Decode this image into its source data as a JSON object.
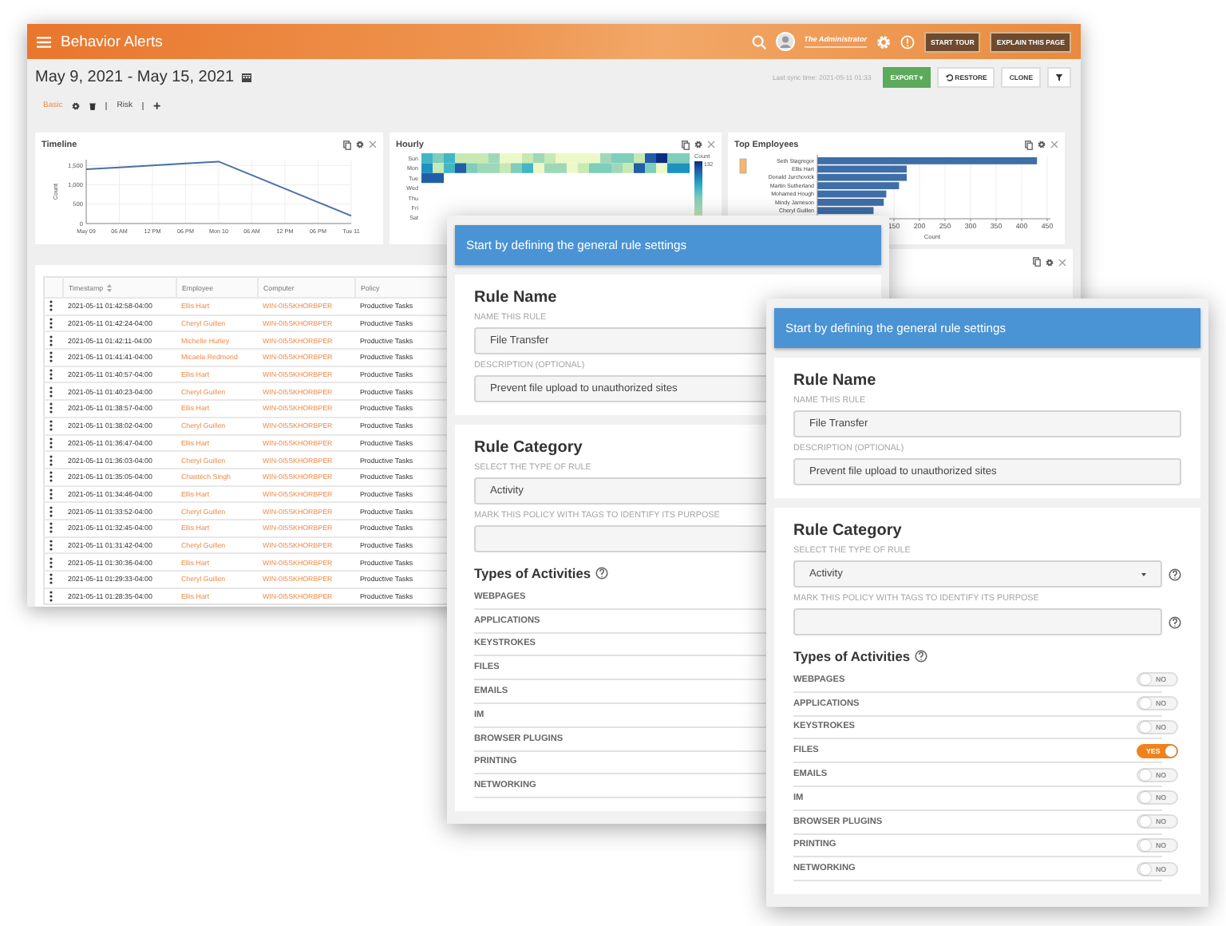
{
  "dashboard": {
    "header": {
      "title": "Behavior Alerts",
      "user": "The Administrator",
      "buttons": [
        "START TOUR",
        "EXPLAIN THIS PAGE"
      ]
    },
    "date_range": "May 9, 2021 - May 15, 2021",
    "sync": "Last sync time: 2021-05-11 01:33",
    "actions": [
      {
        "kind": "export",
        "label": "EXPORT ▾"
      },
      {
        "kind": "restore",
        "label": "RESTORE"
      },
      {
        "kind": "plain",
        "label": "CLONE"
      },
      {
        "kind": "filter"
      }
    ],
    "tabs": [
      {
        "label": "Basic",
        "selected": true
      },
      {
        "label": "Risk",
        "selected": false
      }
    ],
    "add_tab": "+",
    "panels": [
      {
        "title": "Timeline",
        "chart_data": {
          "type": "line",
          "ylabel": "Count",
          "grid": true,
          "ylim": [
            0,
            1650
          ],
          "categories": [
            "May 09",
            "06 AM",
            "12 PM",
            "06 PM",
            "Mon 10",
            "06 AM",
            "12 PM",
            "06 PM",
            "Tue 11"
          ],
          "series": [
            {
              "color": "#4a6fa5",
              "values": [
                1400,
                1450,
                1500,
                1550,
                1600,
                1250,
                900,
                550,
                200
              ]
            }
          ],
          "yticks": [
            {
              "value": 0,
              "label": "0"
            },
            {
              "value": 500,
              "label": "500"
            },
            {
              "value": 1000,
              "label": "1,000"
            },
            {
              "value": 1500,
              "label": "1,500"
            }
          ]
        }
      },
      {
        "kind": "heatmap",
        "title": "Hourly",
        "days": [
          "Sun",
          "Mon",
          "Tue",
          "Wed",
          "Thu",
          "Fri",
          "Sat"
        ],
        "legend_title": "Count",
        "legend_max": "132"
      },
      {
        "title": "Top Employees",
        "chart_data": {
          "type": "bar",
          "orientation": "horizontal",
          "xlabel": "Count",
          "grid": true,
          "xlim": [
            0,
            450
          ],
          "categories": [
            "Seth Stagregor",
            "Ellis Hart",
            "Donald Jurchovick",
            "Martin Sutherland",
            "Mohamed Hough",
            "Mindy Jameson",
            "Cheryl Guillen"
          ],
          "series": [
            {
              "color": "#3f6ea8",
              "values": [
                430,
                175,
                175,
                160,
                135,
                130,
                110
              ]
            }
          ],
          "xticks": [
            150,
            200,
            250,
            300,
            350,
            400,
            450
          ]
        }
      }
    ],
    "table": {
      "columns": [
        "Timestamp",
        "Employee",
        "Computer",
        "Policy"
      ],
      "rows": [
        [
          "2021-05-11 01:42:58-04:00",
          "Ellis Hart",
          "WIN-0I5SKHORBPER",
          "Productive Tasks"
        ],
        [
          "2021-05-11 01:42:24-04:00",
          "Cheryl Guillen",
          "WIN-0I5SKHORBPER",
          "Productive Tasks"
        ],
        [
          "2021-05-11 01:42:11-04:00",
          "Michelle Hurley",
          "WIN-0I5SKHORBPER",
          "Productive Tasks"
        ],
        [
          "2021-05-11 01:41:41-04:00",
          "Micaela Redmond",
          "WIN-0I5SKHORBPER",
          "Productive Tasks"
        ],
        [
          "2021-05-11 01:40:57-04:00",
          "Ellis Hart",
          "WIN-0I5SKHORBPER",
          "Productive Tasks"
        ],
        [
          "2021-05-11 01:40:23-04:00",
          "Cheryl Guillen",
          "WIN-0I5SKHORBPER",
          "Productive Tasks"
        ],
        [
          "2021-05-11 01:38:57-04:00",
          "Ellis Hart",
          "WIN-0I5SKHORBPER",
          "Productive Tasks"
        ],
        [
          "2021-05-11 01:38:02-04:00",
          "Cheryl Guillen",
          "WIN-0I5SKHORBPER",
          "Productive Tasks"
        ],
        [
          "2021-05-11 01:36:47-04:00",
          "Ellis Hart",
          "WIN-0I5SKHORBPER",
          "Productive Tasks"
        ],
        [
          "2021-05-11 01:36:03-04:00",
          "Cheryl Guillen",
          "WIN-0I5SKHORBPER",
          "Productive Tasks"
        ],
        [
          "2021-05-11 01:35:05-04:00",
          "Chastech Singh",
          "WIN-0I5SKHORBPER",
          "Productive Tasks"
        ],
        [
          "2021-05-11 01:34:46-04:00",
          "Ellis Hart",
          "WIN-0I5SKHORBPER",
          "Productive Tasks"
        ],
        [
          "2021-05-11 01:33:52-04:00",
          "Cheryl Guillen",
          "WIN-0I5SKHORBPER",
          "Productive Tasks"
        ],
        [
          "2021-05-11 01:32:45-04:00",
          "Ellis Hart",
          "WIN-0I5SKHORBPER",
          "Productive Tasks"
        ],
        [
          "2021-05-11 01:31:42-04:00",
          "Cheryl Guillen",
          "WIN-0I5SKHORBPER",
          "Productive Tasks"
        ],
        [
          "2021-05-11 01:30:36-04:00",
          "Ellis Hart",
          "WIN-0I5SKHORBPER",
          "Productive Tasks"
        ],
        [
          "2021-05-11 01:29:33-04:00",
          "Cheryl Guillen",
          "WIN-0I5SKHORBPER",
          "Productive Tasks"
        ],
        [
          "2021-05-11 01:28:35-04:00",
          "Ellis Hart",
          "WIN-0I5SKHORBPER",
          "Productive Tasks"
        ]
      ]
    }
  },
  "dialogs": [
    {
      "header": "Start by defining the general rule settings",
      "name_section": {
        "title": "Rule Name",
        "name_label": "NAME THIS RULE",
        "name_value": "File Transfer",
        "description_label": "DESCRIPTION (OPTIONAL)",
        "description_value": "Prevent file upload to unauthorized sites"
      },
      "category_section": {
        "title": "Rule Category",
        "type_label": "SELECT THE TYPE OF RULE",
        "type_value": "Activity",
        "tags_label": "MARK THIS POLICY WITH TAGS TO IDENTIFY ITS PURPOSE",
        "activities_title": "Types of Activities"
      },
      "activities": [
        {
          "label": "WEBPAGES"
        },
        {
          "label": "APPLICATIONS"
        },
        {
          "label": "KEYSTROKES"
        },
        {
          "label": "FILES"
        },
        {
          "label": "EMAILS"
        },
        {
          "label": "IM"
        },
        {
          "label": "BROWSER PLUGINS"
        },
        {
          "label": "PRINTING"
        },
        {
          "label": "NETWORKING"
        }
      ]
    },
    {
      "header": "Start by defining the general rule settings",
      "name_section": {
        "title": "Rule Name",
        "name_label": "NAME THIS RULE",
        "name_value": "File Transfer",
        "description_label": "DESCRIPTION (OPTIONAL)",
        "description_value": "Prevent file upload to unauthorized sites"
      },
      "category_section": {
        "title": "Rule Category",
        "type_label": "SELECT THE TYPE OF RULE",
        "type_value": "Activity",
        "tags_label": "MARK THIS POLICY WITH TAGS TO IDENTIFY ITS PURPOSE",
        "activities_title": "Types of Activities",
        "field_help": true
      },
      "activities": [
        {
          "label": "WEBPAGES",
          "on": false,
          "toggle_text": "NO"
        },
        {
          "label": "APPLICATIONS",
          "on": false,
          "toggle_text": "NO"
        },
        {
          "label": "KEYSTROKES",
          "on": false,
          "toggle_text": "NO"
        },
        {
          "label": "FILES",
          "on": true,
          "toggle_text": "YES"
        },
        {
          "label": "EMAILS",
          "on": false,
          "toggle_text": "NO"
        },
        {
          "label": "IM",
          "on": false,
          "toggle_text": "NO"
        },
        {
          "label": "BROWSER PLUGINS",
          "on": false,
          "toggle_text": "NO"
        },
        {
          "label": "PRINTING",
          "on": false,
          "toggle_text": "NO"
        },
        {
          "label": "NETWORKING",
          "on": false,
          "toggle_text": "NO"
        }
      ]
    }
  ]
}
